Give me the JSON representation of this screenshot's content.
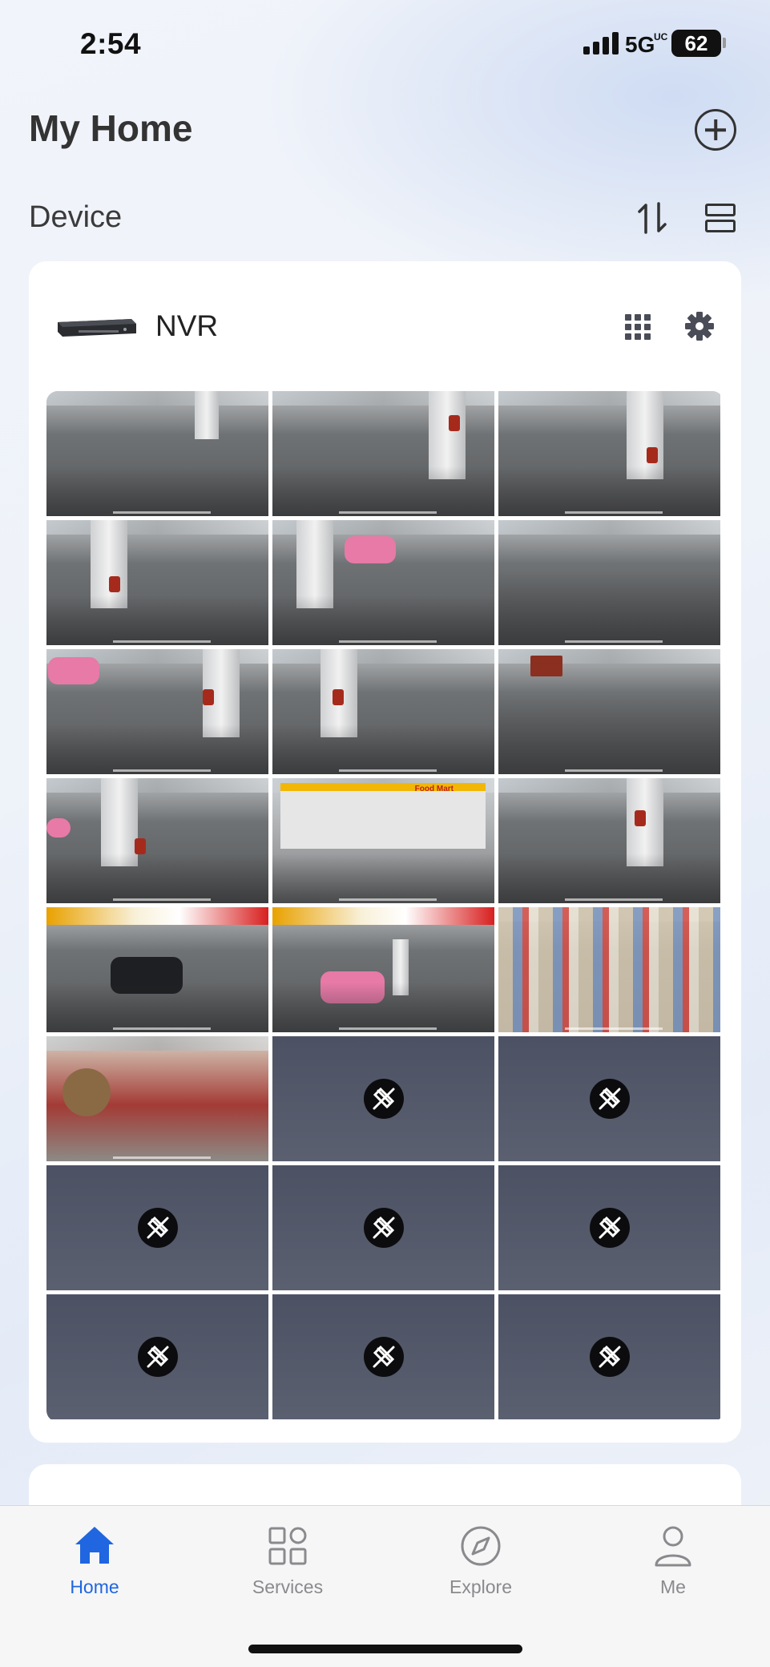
{
  "status_bar": {
    "time": "2:54",
    "network": "5G",
    "network_suffix": "UC",
    "battery": "62"
  },
  "header": {
    "title": "My Home",
    "add_icon": "plus-circle-icon"
  },
  "section": {
    "title": "Device",
    "sort_icon": "sort-arrows-icon",
    "layout_icon": "list-layout-icon"
  },
  "device": {
    "name": "NVR",
    "thumbnail_icon": "nvr-device-icon",
    "grid_icon": "grid-view-icon",
    "settings_icon": "gear-icon",
    "channels": [
      {
        "status": "live",
        "scene": "parking-lot"
      },
      {
        "status": "live",
        "scene": "pump-pillar"
      },
      {
        "status": "live",
        "scene": "pump-pillar-lot"
      },
      {
        "status": "live",
        "scene": "pump-pillar"
      },
      {
        "status": "live",
        "scene": "pink-car-pump"
      },
      {
        "status": "live",
        "scene": "lot-markings"
      },
      {
        "status": "live",
        "scene": "pink-car-lot"
      },
      {
        "status": "live",
        "scene": "pump-pillar"
      },
      {
        "status": "live",
        "scene": "lot-trailer"
      },
      {
        "status": "live",
        "scene": "pump-pillar-cars"
      },
      {
        "status": "live",
        "scene": "food-mart-store"
      },
      {
        "status": "live",
        "scene": "pump-pillar"
      },
      {
        "status": "live",
        "scene": "canopy-suv"
      },
      {
        "status": "live",
        "scene": "canopy-pink-car"
      },
      {
        "status": "live",
        "scene": "store-shelves"
      },
      {
        "status": "live",
        "scene": "cashier-counter"
      },
      {
        "status": "offline",
        "scene": "camera-offline-icon"
      },
      {
        "status": "offline",
        "scene": "camera-offline-icon"
      },
      {
        "status": "offline",
        "scene": "camera-offline-icon"
      },
      {
        "status": "offline",
        "scene": "camera-offline-icon"
      },
      {
        "status": "offline",
        "scene": "camera-offline-icon"
      },
      {
        "status": "offline",
        "scene": "camera-offline-icon"
      },
      {
        "status": "offline",
        "scene": "camera-offline-icon"
      },
      {
        "status": "offline",
        "scene": "camera-offline-icon"
      }
    ],
    "store_sign": "Food Mart"
  },
  "tabs": [
    {
      "label": "Home",
      "icon": "home-icon",
      "active": true
    },
    {
      "label": "Services",
      "icon": "grid-apps-icon",
      "active": false
    },
    {
      "label": "Explore",
      "icon": "compass-icon",
      "active": false
    },
    {
      "label": "Me",
      "icon": "person-icon",
      "active": false
    }
  ],
  "colors": {
    "accent": "#1f66e0",
    "offline_tile": "#4c5263",
    "text_dark": "#333333"
  }
}
